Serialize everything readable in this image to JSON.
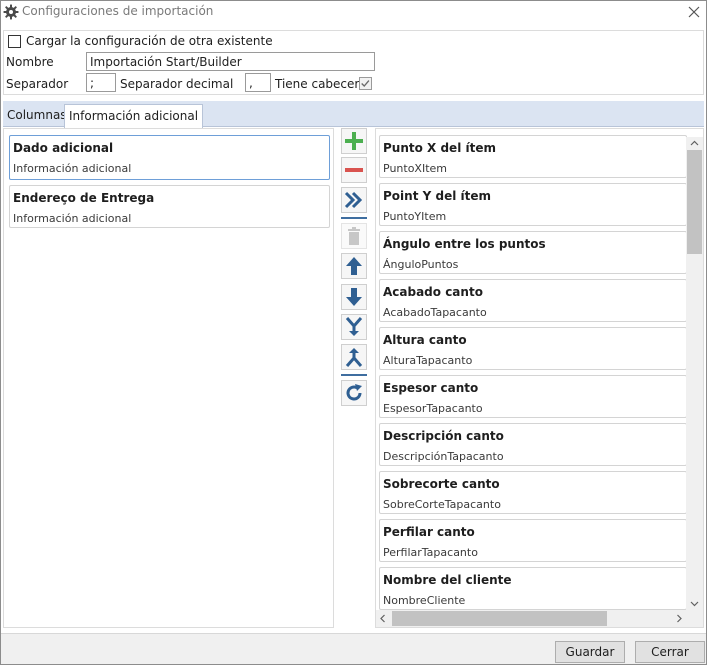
{
  "window": {
    "title": "Configuraciones de importación"
  },
  "config": {
    "load_existing_label": "Cargar la configuración de otra existente",
    "load_existing_checked": false,
    "name_label": "Nombre",
    "name_value": "Importación Start/Builder",
    "separator_label": "Separador",
    "separator_value": ";",
    "decimal_separator_label": "Separador decimal",
    "decimal_separator_value": ",",
    "has_header_label": "Tiene cabecera",
    "has_header_checked": true
  },
  "tabs": [
    {
      "label": "Columnas",
      "active": false
    },
    {
      "label": "Información adicional",
      "active": true
    }
  ],
  "selected_items": [
    {
      "title": "Dado adicional",
      "subtitle": "Información adicional",
      "selected": true
    },
    {
      "title": "Endereço de Entrega",
      "subtitle": "Información adicional",
      "selected": false
    }
  ],
  "toolbar": {
    "icons": [
      "add-icon",
      "remove-icon",
      "move-all-icon",
      "delete-icon",
      "move-up-icon",
      "move-down-icon",
      "merge-icon",
      "split-icon",
      "refresh-icon"
    ]
  },
  "available_items": [
    {
      "title": "Punto X del ítem",
      "subtitle": "PuntoXItem"
    },
    {
      "title": "Point Y del ítem",
      "subtitle": "PuntoYItem"
    },
    {
      "title": "Ángulo entre los puntos",
      "subtitle": "ÁnguloPuntos"
    },
    {
      "title": "Acabado canto",
      "subtitle": "AcabadoTapacanto"
    },
    {
      "title": "Altura canto",
      "subtitle": "AlturaTapacanto"
    },
    {
      "title": "Espesor canto",
      "subtitle": "EspesorTapacanto"
    },
    {
      "title": "Descripción canto",
      "subtitle": "DescripciónTapacanto"
    },
    {
      "title": "Sobrecorte canto",
      "subtitle": "SobreCorteTapacanto"
    },
    {
      "title": "Perfilar canto",
      "subtitle": "PerfilarTapacanto"
    },
    {
      "title": "Nombre del cliente",
      "subtitle": "NombreCliente"
    }
  ],
  "footer": {
    "save_label": "Guardar",
    "close_label": "Cerrar"
  },
  "colors": {
    "accent": "#3f6ea0",
    "tab_strip": "#dbe4f2",
    "add_green": "#4caf50",
    "remove_red": "#d9534f"
  }
}
